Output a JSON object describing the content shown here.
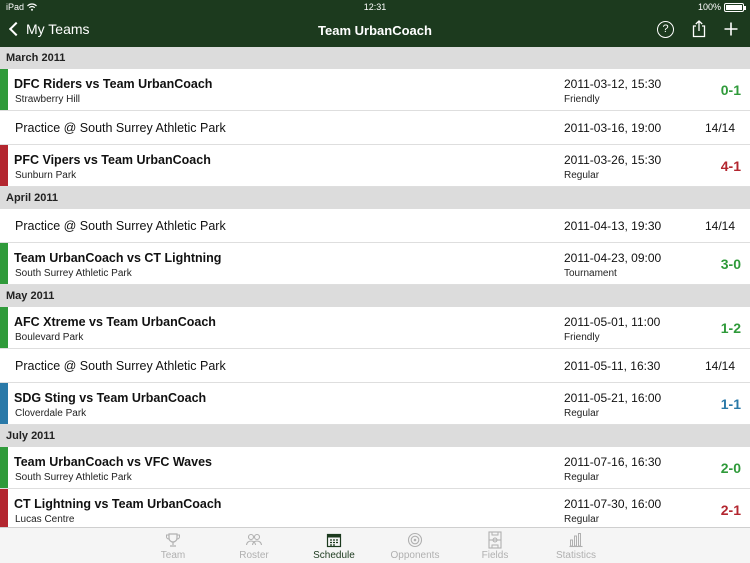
{
  "status_bar": {
    "device": "iPad",
    "time": "12:31",
    "battery": "100%"
  },
  "nav": {
    "back_label": "My Teams",
    "title": "Team UrbanCoach"
  },
  "colors": {
    "win": "#2f9a3a",
    "loss": "#b3262f",
    "tie": "#2a79a8",
    "nav_bg": "#1c3a1e"
  },
  "sections": [
    {
      "month": "March 2011",
      "rows": [
        {
          "title": "DFC Riders vs Team UrbanCoach",
          "venue": "Strawberry Hill",
          "date": "2011-03-12, 15:30",
          "type": "Friendly",
          "score": "0-1",
          "result": "win"
        },
        {
          "title": "Practice @  South Surrey Athletic Park",
          "date": "2011-03-16, 19:00",
          "count": "14/14"
        },
        {
          "title": "PFC Vipers vs Team UrbanCoach",
          "venue": "Sunburn Park",
          "date": "2011-03-26, 15:30",
          "type": "Regular",
          "score": "4-1",
          "result": "loss"
        }
      ]
    },
    {
      "month": "April 2011",
      "rows": [
        {
          "title": "Practice @  South Surrey Athletic Park",
          "date": "2011-04-13, 19:30",
          "count": "14/14"
        },
        {
          "title": "Team UrbanCoach vs CT Lightning",
          "venue": "South Surrey Athletic Park",
          "date": "2011-04-23, 09:00",
          "type": "Tournament",
          "score": "3-0",
          "result": "win"
        }
      ]
    },
    {
      "month": "May 2011",
      "rows": [
        {
          "title": "AFC Xtreme vs Team UrbanCoach",
          "venue": "Boulevard Park",
          "date": "2011-05-01, 11:00",
          "type": "Friendly",
          "score": "1-2",
          "result": "win"
        },
        {
          "title": "Practice @  South Surrey Athletic Park",
          "date": "2011-05-11, 16:30",
          "count": "14/14"
        },
        {
          "title": "SDG Sting vs Team UrbanCoach",
          "venue": "Cloverdale Park",
          "date": "2011-05-21, 16:00",
          "type": "Regular",
          "score": "1-1",
          "result": "tie"
        }
      ]
    },
    {
      "month": "July 2011",
      "rows": [
        {
          "title": "Team UrbanCoach vs VFC Waves",
          "venue": "South Surrey Athletic Park",
          "date": "2011-07-16, 16:30",
          "type": "Regular",
          "score": "2-0",
          "result": "win"
        },
        {
          "title": "CT Lightning vs Team UrbanCoach",
          "venue": "Lucas Centre",
          "date": "2011-07-30, 16:00",
          "type": "Regular",
          "score": "2-1",
          "result": "loss"
        }
      ]
    }
  ],
  "tabs": [
    {
      "label": "Team",
      "icon": "trophy-icon"
    },
    {
      "label": "Roster",
      "icon": "people-icon"
    },
    {
      "label": "Schedule",
      "icon": "calendar-icon",
      "active": true
    },
    {
      "label": "Opponents",
      "icon": "target-icon"
    },
    {
      "label": "Fields",
      "icon": "field-icon"
    },
    {
      "label": "Statistics",
      "icon": "bar-chart-icon"
    }
  ]
}
